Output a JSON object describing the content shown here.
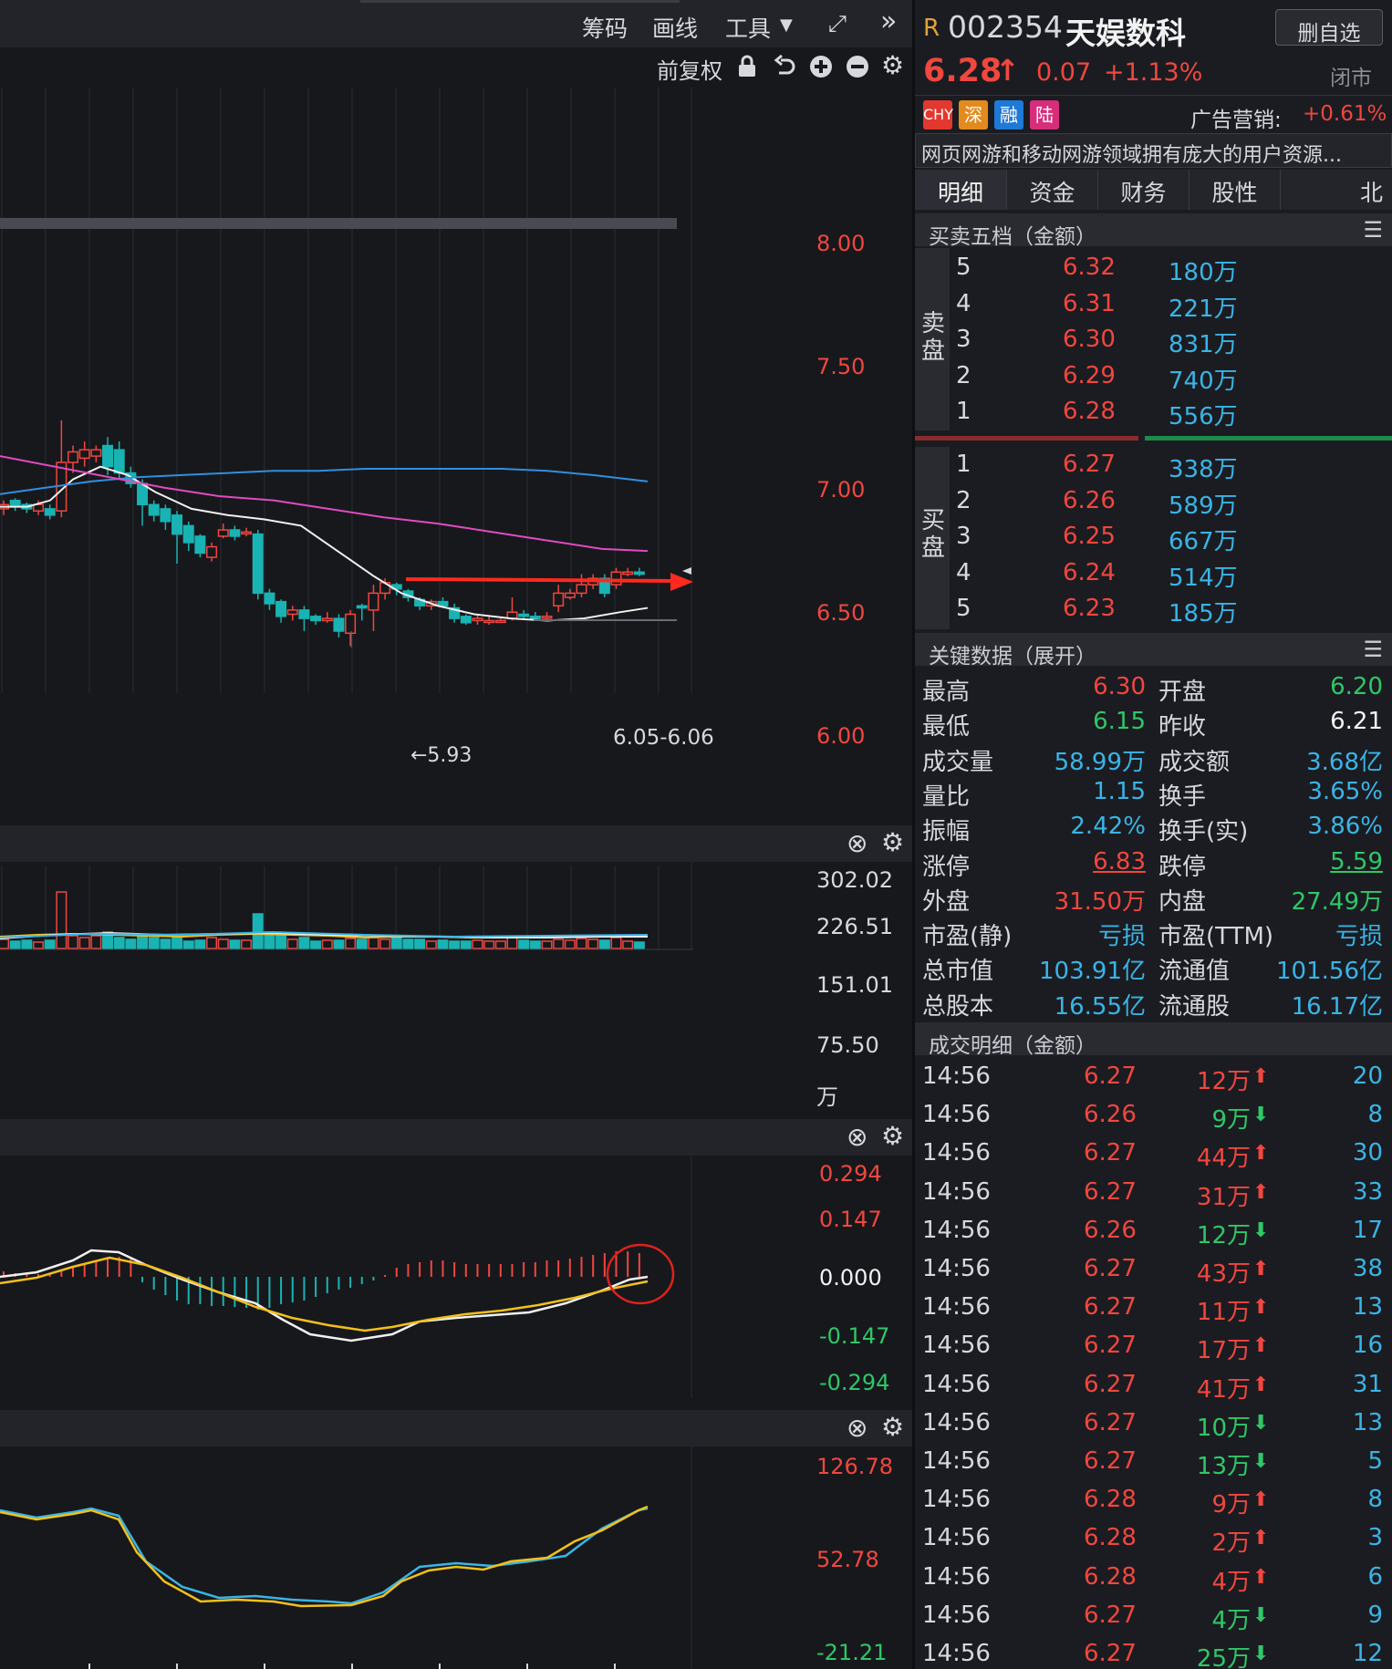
{
  "toolbar": {
    "chips": "筹码",
    "draw": "画线",
    "tools": "工具",
    "adjust": "前复权"
  },
  "icons": {
    "dropdown": "chevron-down-icon",
    "expand": "expand-arrows-icon",
    "more": "double-chevron-right-icon",
    "lock": "lock-icon",
    "undo": "undo-icon",
    "zoom_in": "plus-circle-icon",
    "zoom_out": "minus-circle-icon",
    "settings": "gear-icon",
    "close": "close-circle-icon"
  },
  "main_chart": {
    "price_axis": [
      "8.00",
      "7.50",
      "7.00",
      "6.50",
      "6.00"
    ],
    "low_label": "←5.93",
    "range_label": "6.05-6.06"
  },
  "volume": {
    "axis": [
      "302.02",
      "226.51",
      "151.01",
      "75.50"
    ],
    "unit": "万"
  },
  "macd": {
    "axis_pos": [
      "0.294",
      "0.147"
    ],
    "zero": "0.000",
    "axis_neg": [
      "-0.147",
      "-0.294"
    ]
  },
  "kdj": {
    "axis": [
      "126.78",
      "52.78",
      "-21.21"
    ]
  },
  "stock": {
    "badge": "R",
    "code": "002354",
    "name": "天娱数科",
    "remove_label": "删自选",
    "price": "6.28",
    "arrow": "↑",
    "change": "0.07",
    "pct": "+1.13%",
    "status": "闭市",
    "tags": [
      "CHY",
      "深",
      "融",
      "陆"
    ],
    "sector_label": "广告营销:",
    "sector_pct": "+0.61%",
    "desc": "网页网游和移动网游领域拥有庞大的用户资源..."
  },
  "tabs": [
    "明细",
    "资金",
    "财务",
    "股性",
    "北"
  ],
  "orderbook": {
    "title": "买卖五档（金额）",
    "sell_label": "卖盘",
    "buy_label": "买盘",
    "sell": [
      {
        "lvl": "5",
        "price": "6.32",
        "amt": "180万"
      },
      {
        "lvl": "4",
        "price": "6.31",
        "amt": "221万"
      },
      {
        "lvl": "3",
        "price": "6.30",
        "amt": "831万"
      },
      {
        "lvl": "2",
        "price": "6.29",
        "amt": "740万"
      },
      {
        "lvl": "1",
        "price": "6.28",
        "amt": "556万"
      }
    ],
    "buy": [
      {
        "lvl": "1",
        "price": "6.27",
        "amt": "338万"
      },
      {
        "lvl": "2",
        "price": "6.26",
        "amt": "589万"
      },
      {
        "lvl": "3",
        "price": "6.25",
        "amt": "667万"
      },
      {
        "lvl": "4",
        "price": "6.24",
        "amt": "514万"
      },
      {
        "lvl": "5",
        "price": "6.23",
        "amt": "185万"
      }
    ]
  },
  "keydata": {
    "title": "关键数据（展开）",
    "rows": [
      {
        "l1": "最高",
        "v1": "6.30",
        "c1": "r",
        "l2": "开盘",
        "v2": "6.20",
        "c2": "g"
      },
      {
        "l1": "最低",
        "v1": "6.15",
        "c1": "g",
        "l2": "昨收",
        "v2": "6.21",
        "c2": "w"
      },
      {
        "l1": "成交量",
        "v1": "58.99万",
        "c1": "c",
        "l2": "成交额",
        "v2": "3.68亿",
        "c2": "c"
      },
      {
        "l1": "量比",
        "v1": "1.15",
        "c1": "c",
        "l2": "换手",
        "v2": "3.65%",
        "c2": "c"
      },
      {
        "l1": "振幅",
        "v1": "2.42%",
        "c1": "c",
        "l2": "换手(实)",
        "v2": "3.86%",
        "c2": "c"
      },
      {
        "l1": "涨停",
        "v1": "6.83",
        "c1": "r",
        "l2": "跌停",
        "v2": "5.59",
        "c2": "g"
      },
      {
        "l1": "外盘",
        "v1": "31.50万",
        "c1": "r",
        "l2": "内盘",
        "v2": "27.49万",
        "c2": "g"
      },
      {
        "l1": "市盈(静)",
        "v1": "亏损",
        "c1": "c",
        "l2": "市盈(TTM)",
        "v2": "亏损",
        "c2": "c"
      },
      {
        "l1": "总市值",
        "v1": "103.91亿",
        "c1": "c",
        "l2": "流通值",
        "v2": "101.56亿",
        "c2": "c"
      },
      {
        "l1": "总股本",
        "v1": "16.55亿",
        "c1": "c",
        "l2": "流通股",
        "v2": "16.17亿",
        "c2": "c"
      }
    ]
  },
  "trades": {
    "title": "成交明细（金额）",
    "rows": [
      {
        "t": "14:56",
        "p": "6.27",
        "pc": "r",
        "a": "12万",
        "dir": "up",
        "n": "20"
      },
      {
        "t": "14:56",
        "p": "6.26",
        "pc": "r",
        "a": "9万",
        "dir": "down",
        "n": "8"
      },
      {
        "t": "14:56",
        "p": "6.27",
        "pc": "r",
        "a": "44万",
        "dir": "up",
        "n": "30"
      },
      {
        "t": "14:56",
        "p": "6.27",
        "pc": "r",
        "a": "31万",
        "dir": "up",
        "n": "33"
      },
      {
        "t": "14:56",
        "p": "6.26",
        "pc": "r",
        "a": "12万",
        "dir": "down",
        "n": "17"
      },
      {
        "t": "14:56",
        "p": "6.27",
        "pc": "r",
        "a": "43万",
        "dir": "up",
        "n": "38"
      },
      {
        "t": "14:56",
        "p": "6.27",
        "pc": "r",
        "a": "11万",
        "dir": "up",
        "n": "13"
      },
      {
        "t": "14:56",
        "p": "6.27",
        "pc": "r",
        "a": "17万",
        "dir": "up",
        "n": "16"
      },
      {
        "t": "14:56",
        "p": "6.27",
        "pc": "r",
        "a": "41万",
        "dir": "up",
        "n": "31"
      },
      {
        "t": "14:56",
        "p": "6.27",
        "pc": "r",
        "a": "10万",
        "dir": "down",
        "n": "13"
      },
      {
        "t": "14:56",
        "p": "6.27",
        "pc": "r",
        "a": "13万",
        "dir": "down",
        "n": "5"
      },
      {
        "t": "14:56",
        "p": "6.28",
        "pc": "r",
        "a": "9万",
        "dir": "up",
        "n": "8"
      },
      {
        "t": "14:56",
        "p": "6.28",
        "pc": "r",
        "a": "2万",
        "dir": "up",
        "n": "3"
      },
      {
        "t": "14:56",
        "p": "6.28",
        "pc": "r",
        "a": "4万",
        "dir": "up",
        "n": "6"
      },
      {
        "t": "14:56",
        "p": "6.27",
        "pc": "r",
        "a": "4万",
        "dir": "down",
        "n": "9"
      },
      {
        "t": "14:56",
        "p": "6.27",
        "pc": "r",
        "a": "25万",
        "dir": "down",
        "n": "12"
      }
    ]
  },
  "colors": {
    "up": "#f0473f",
    "down": "#2fc768",
    "cyan": "#3ab4e6",
    "candle_down": "#19b3b3",
    "ma_white": "#f0f0f0",
    "ma_blue": "#2f8fe0",
    "ma_pink": "#e04bc0",
    "yellow": "#f2c01a"
  }
}
